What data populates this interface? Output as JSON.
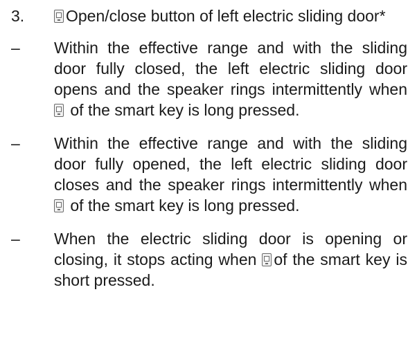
{
  "step": {
    "number": "3.",
    "icon": "door-key-button-icon",
    "title": "Open/close button of left electric sliding door*"
  },
  "bullets": [
    {
      "marker": "–",
      "text_before": "Within the effective range and with the sliding door fully closed, the left electric sliding door opens and the speaker rings intermittently when",
      "icon": "door-key-button-icon",
      "text_after": "of the smart key is long pressed."
    },
    {
      "marker": "–",
      "text_before": "Within the effective range and with the sliding door fully opened, the left electric sliding door closes and the speaker rings intermittently when",
      "icon": "door-key-button-icon",
      "text_after": "of the smart key is long pressed."
    },
    {
      "marker": "–",
      "text_before": "When the electric sliding door is opening or closing, it stops acting when",
      "icon": "door-key-button-icon",
      "text_after": "of the smart key is short pressed."
    }
  ]
}
